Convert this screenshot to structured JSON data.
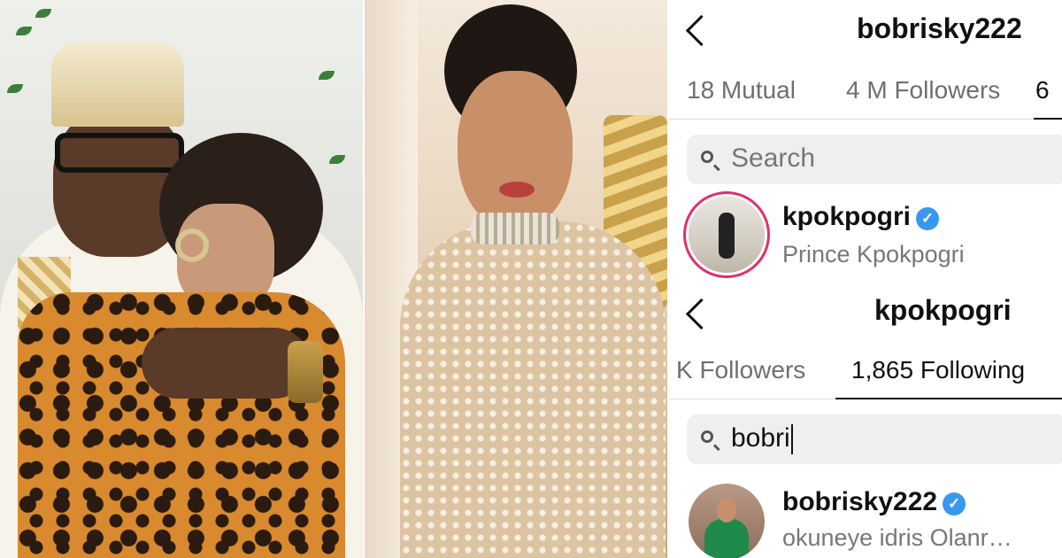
{
  "top_screen": {
    "title": "bobrisky222",
    "tabs": [
      {
        "label": "18 Mutual"
      },
      {
        "label": "4 M Followers"
      },
      {
        "label": "6"
      }
    ],
    "search": {
      "placeholder": "Search"
    },
    "result": {
      "username": "kpokpogri",
      "full_name": "Prince Kpokpogri",
      "verified": true
    }
  },
  "bottom_screen": {
    "title": "kpokpogri",
    "tabs": [
      {
        "label": "K Followers"
      },
      {
        "label": "1,865 Following"
      }
    ],
    "active_tab_index": 1,
    "search": {
      "value": "bobri"
    },
    "result": {
      "username": "bobrisky222",
      "full_name": "okuneye idris Olanr…",
      "verified": true
    }
  },
  "colors": {
    "verified_badge": "#3897f0",
    "story_ring": "#e1306c"
  },
  "icons": [
    "back-chevron-icon",
    "search-icon",
    "verified-badge-icon"
  ]
}
